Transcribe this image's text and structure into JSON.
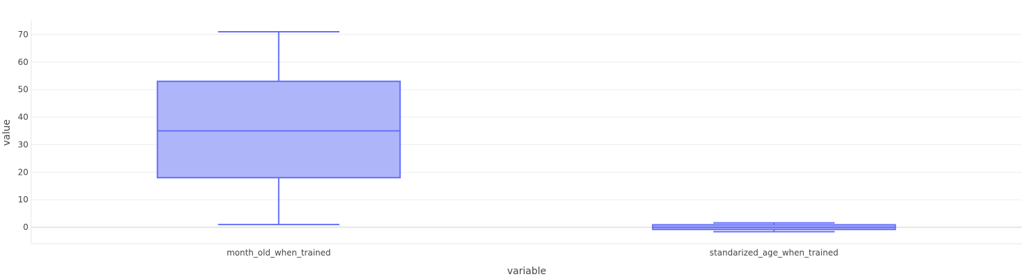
{
  "chart_data": {
    "type": "box",
    "xlabel": "variable",
    "ylabel": "value",
    "ylim": [
      -6,
      75
    ],
    "y_ticks": [
      0,
      10,
      20,
      30,
      40,
      50,
      60,
      70
    ],
    "grid": true,
    "color": "#636efa",
    "fill_color": "#aab1f9",
    "categories": [
      "month_old_when_trained",
      "standarized_age_when_trained"
    ],
    "boxes": [
      {
        "category": "month_old_when_trained",
        "min": 1,
        "q1": 18,
        "median": 35,
        "q3": 53,
        "max": 71
      },
      {
        "category": "standarized_age_when_trained",
        "min": -1.6,
        "q1": -0.8,
        "median": 0.0,
        "q3": 0.9,
        "max": 1.6
      }
    ]
  }
}
